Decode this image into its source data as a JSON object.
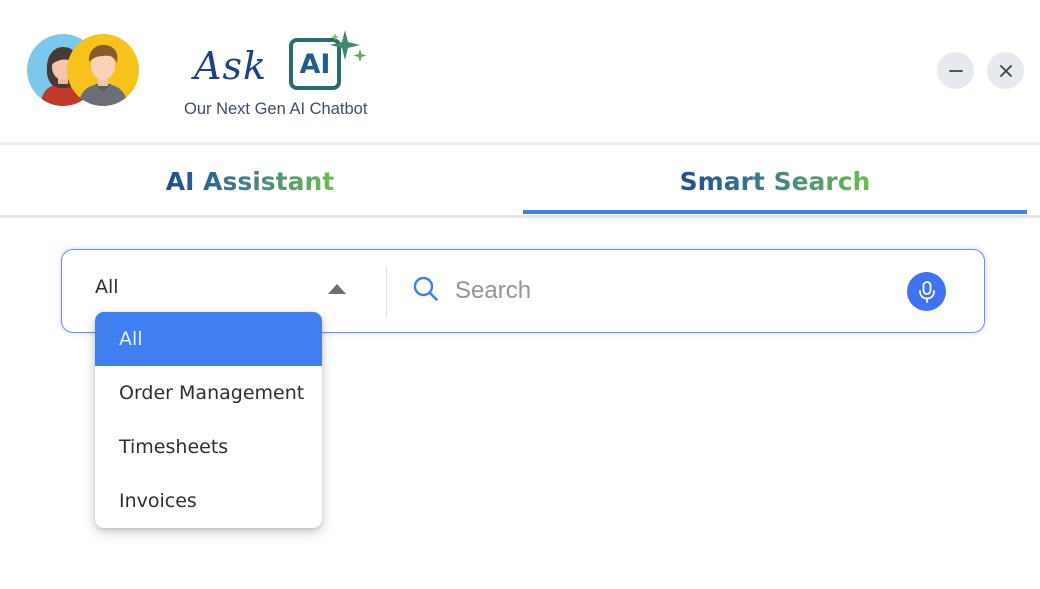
{
  "header": {
    "logo": {
      "ask_text": "Ask",
      "ai_text": "AI",
      "tagline": "Our Next Gen AI Chatbot"
    },
    "icons": {
      "minimize": "minimize-icon",
      "close": "close-icon"
    }
  },
  "tabs": [
    {
      "label": "AI Assistant",
      "active": false
    },
    {
      "label": "Smart Search",
      "active": true
    }
  ],
  "search": {
    "category_selected": "All",
    "placeholder": "Search",
    "value": "",
    "icons": {
      "search": "search-icon",
      "mic": "microphone-icon",
      "caret": "caret-up-icon"
    }
  },
  "dropdown": {
    "open": true,
    "options": [
      "All",
      "Order Management",
      "Timesheets",
      "Invoices"
    ],
    "selected_index": 0
  },
  "colors": {
    "accent": "#3f7ff0",
    "mic_button": "#3f73f0",
    "brand_navy": "#1f4a91",
    "brand_green": "#6bbd4c"
  }
}
